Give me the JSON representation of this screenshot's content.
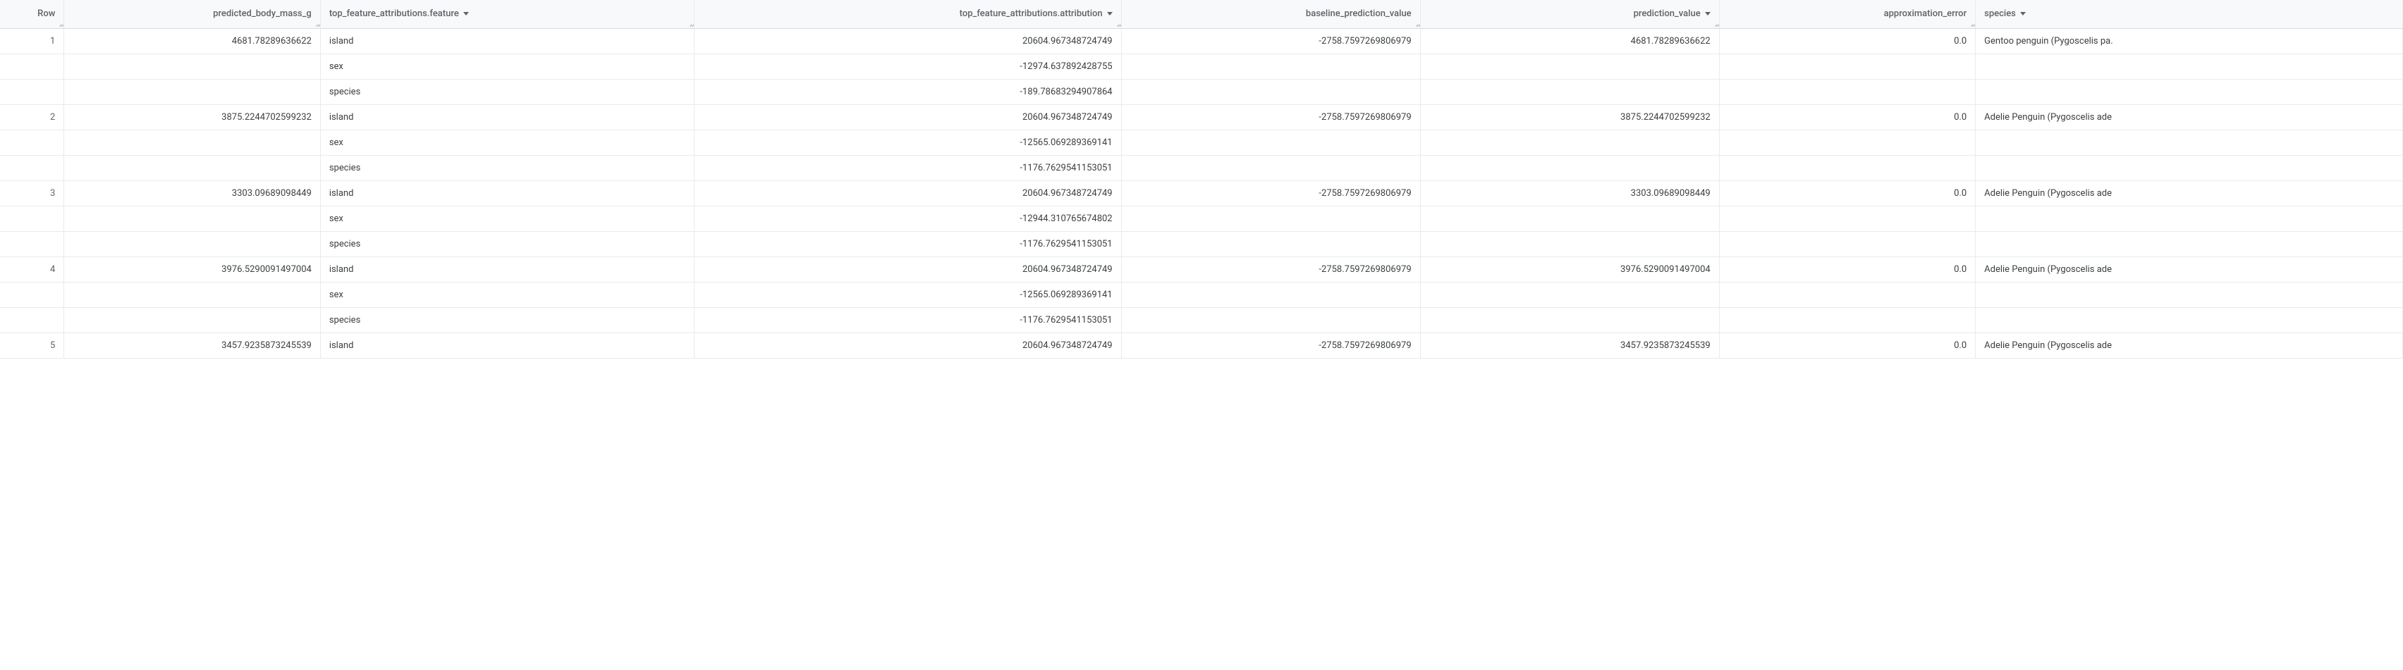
{
  "headers": {
    "row": "Row",
    "predicted_body_mass": "predicted_body_mass_g",
    "feature": "top_feature_attributions.feature",
    "attribution": "top_feature_attributions.attribution",
    "baseline": "baseline_prediction_value",
    "prediction": "prediction_value",
    "error": "approximation_error",
    "species": "species"
  },
  "rows": [
    {
      "row": "1",
      "predicted_body_mass": "4681.78289636622",
      "baseline": "-2758.7597269806979",
      "prediction": "4681.78289636622",
      "error": "0.0",
      "species": "Gentoo penguin (Pygoscelis pa.",
      "features": [
        {
          "feature": "island",
          "attribution": "20604.967348724749"
        },
        {
          "feature": "sex",
          "attribution": "-12974.637892428755"
        },
        {
          "feature": "species",
          "attribution": "-189.78683294907864"
        }
      ]
    },
    {
      "row": "2",
      "predicted_body_mass": "3875.2244702599232",
      "baseline": "-2758.7597269806979",
      "prediction": "3875.2244702599232",
      "error": "0.0",
      "species": "Adelie Penguin (Pygoscelis ade",
      "features": [
        {
          "feature": "island",
          "attribution": "20604.967348724749"
        },
        {
          "feature": "sex",
          "attribution": "-12565.069289369141"
        },
        {
          "feature": "species",
          "attribution": "-1176.7629541153051"
        }
      ]
    },
    {
      "row": "3",
      "predicted_body_mass": "3303.09689098449",
      "baseline": "-2758.7597269806979",
      "prediction": "3303.09689098449",
      "error": "0.0",
      "species": "Adelie Penguin (Pygoscelis ade",
      "features": [
        {
          "feature": "island",
          "attribution": "20604.967348724749"
        },
        {
          "feature": "sex",
          "attribution": "-12944.310765674802"
        },
        {
          "feature": "species",
          "attribution": "-1176.7629541153051"
        }
      ]
    },
    {
      "row": "4",
      "predicted_body_mass": "3976.5290091497004",
      "baseline": "-2758.7597269806979",
      "prediction": "3976.5290091497004",
      "error": "0.0",
      "species": "Adelie Penguin (Pygoscelis ade",
      "features": [
        {
          "feature": "island",
          "attribution": "20604.967348724749"
        },
        {
          "feature": "sex",
          "attribution": "-12565.069289369141"
        },
        {
          "feature": "species",
          "attribution": "-1176.7629541153051"
        }
      ]
    },
    {
      "row": "5",
      "predicted_body_mass": "3457.9235873245539",
      "baseline": "-2758.7597269806979",
      "prediction": "3457.9235873245539",
      "error": "0.0",
      "species": "Adelie Penguin (Pygoscelis ade",
      "features": [
        {
          "feature": "island",
          "attribution": "20604.967348724749"
        }
      ]
    }
  ]
}
